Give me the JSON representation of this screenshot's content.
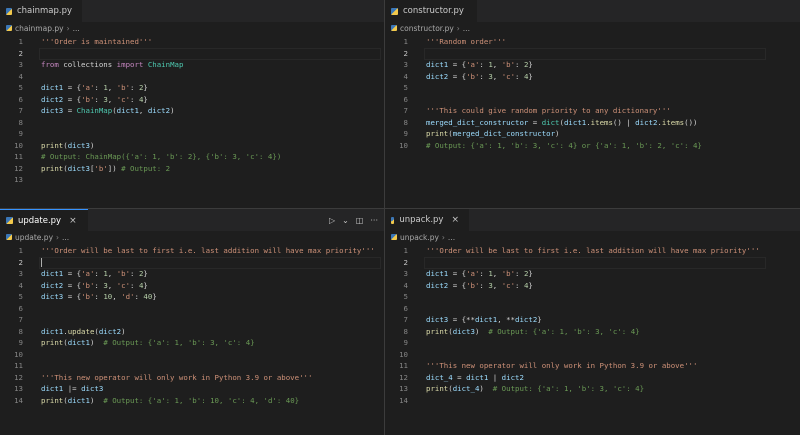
{
  "panes": {
    "chainmap": {
      "tab": "chainmap.py",
      "crumb": "chainmap.py",
      "ellipsis": "...",
      "lines": [
        [
          {
            "t": "'''Order is maintained'''",
            "c": "str"
          }
        ],
        [],
        [
          {
            "t": "from",
            "c": "kw"
          },
          {
            "t": " collections ",
            "c": "txt"
          },
          {
            "t": "import",
            "c": "kw"
          },
          {
            "t": " ChainMap",
            "c": "cls"
          }
        ],
        [],
        [
          {
            "t": "dict1",
            "c": "var"
          },
          {
            "t": " = {",
            "c": "txt"
          },
          {
            "t": "'a'",
            "c": "str"
          },
          {
            "t": ": ",
            "c": "txt"
          },
          {
            "t": "1",
            "c": "num"
          },
          {
            "t": ", ",
            "c": "txt"
          },
          {
            "t": "'b'",
            "c": "str"
          },
          {
            "t": ": ",
            "c": "txt"
          },
          {
            "t": "2",
            "c": "num"
          },
          {
            "t": "}",
            "c": "txt"
          }
        ],
        [
          {
            "t": "dict2",
            "c": "var"
          },
          {
            "t": " = {",
            "c": "txt"
          },
          {
            "t": "'b'",
            "c": "str"
          },
          {
            "t": ": ",
            "c": "txt"
          },
          {
            "t": "3",
            "c": "num"
          },
          {
            "t": ", ",
            "c": "txt"
          },
          {
            "t": "'c'",
            "c": "str"
          },
          {
            "t": ": ",
            "c": "txt"
          },
          {
            "t": "4",
            "c": "num"
          },
          {
            "t": "}",
            "c": "txt"
          }
        ],
        [
          {
            "t": "dict3",
            "c": "var"
          },
          {
            "t": " = ",
            "c": "txt"
          },
          {
            "t": "ChainMap",
            "c": "cls"
          },
          {
            "t": "(",
            "c": "txt"
          },
          {
            "t": "dict1",
            "c": "var"
          },
          {
            "t": ", ",
            "c": "txt"
          },
          {
            "t": "dict2",
            "c": "var"
          },
          {
            "t": ")",
            "c": "txt"
          }
        ],
        [],
        [],
        [
          {
            "t": "print",
            "c": "fn"
          },
          {
            "t": "(",
            "c": "txt"
          },
          {
            "t": "dict3",
            "c": "var"
          },
          {
            "t": ")",
            "c": "txt"
          }
        ],
        [
          {
            "t": "# Output: ChainMap({'a': 1, 'b': 2}, {'b': 3, 'c': 4})",
            "c": "com"
          }
        ],
        [
          {
            "t": "print",
            "c": "fn"
          },
          {
            "t": "(",
            "c": "txt"
          },
          {
            "t": "dict3",
            "c": "var"
          },
          {
            "t": "[",
            "c": "txt"
          },
          {
            "t": "'b'",
            "c": "str"
          },
          {
            "t": "]) ",
            "c": "txt"
          },
          {
            "t": "# Output: 2",
            "c": "com"
          }
        ],
        []
      ]
    },
    "constructor": {
      "tab": "constructor.py",
      "crumb": "constructor.py",
      "ellipsis": "...",
      "lines": [
        [
          {
            "t": "'''Random order'''",
            "c": "str"
          }
        ],
        [],
        [
          {
            "t": "dict1",
            "c": "var"
          },
          {
            "t": " = {",
            "c": "txt"
          },
          {
            "t": "'a'",
            "c": "str"
          },
          {
            "t": ": ",
            "c": "txt"
          },
          {
            "t": "1",
            "c": "num"
          },
          {
            "t": ", ",
            "c": "txt"
          },
          {
            "t": "'b'",
            "c": "str"
          },
          {
            "t": ": ",
            "c": "txt"
          },
          {
            "t": "2",
            "c": "num"
          },
          {
            "t": "}",
            "c": "txt"
          }
        ],
        [
          {
            "t": "dict2",
            "c": "var"
          },
          {
            "t": " = {",
            "c": "txt"
          },
          {
            "t": "'b'",
            "c": "str"
          },
          {
            "t": ": ",
            "c": "txt"
          },
          {
            "t": "3",
            "c": "num"
          },
          {
            "t": ", ",
            "c": "txt"
          },
          {
            "t": "'c'",
            "c": "str"
          },
          {
            "t": ": ",
            "c": "txt"
          },
          {
            "t": "4",
            "c": "num"
          },
          {
            "t": "}",
            "c": "txt"
          }
        ],
        [],
        [],
        [
          {
            "t": "'''This could give random priority to any dictionary'''",
            "c": "str"
          }
        ],
        [
          {
            "t": "merged_dict_constructor",
            "c": "var"
          },
          {
            "t": " = ",
            "c": "txt"
          },
          {
            "t": "dict",
            "c": "cls"
          },
          {
            "t": "(",
            "c": "txt"
          },
          {
            "t": "dict1",
            "c": "var"
          },
          {
            "t": ".",
            "c": "txt"
          },
          {
            "t": "items",
            "c": "fn"
          },
          {
            "t": "() | ",
            "c": "txt"
          },
          {
            "t": "dict2",
            "c": "var"
          },
          {
            "t": ".",
            "c": "txt"
          },
          {
            "t": "items",
            "c": "fn"
          },
          {
            "t": "())",
            "c": "txt"
          }
        ],
        [
          {
            "t": "print",
            "c": "fn"
          },
          {
            "t": "(",
            "c": "txt"
          },
          {
            "t": "merged_dict_constructor",
            "c": "var"
          },
          {
            "t": ")",
            "c": "txt"
          }
        ],
        [
          {
            "t": "# Output: {'a': 1, 'b': 3, 'c': 4} or {'a': 1, 'b': 2, 'c': 4}",
            "c": "com"
          }
        ]
      ]
    },
    "update": {
      "tab": "update.py",
      "crumb": "update.py",
      "ellipsis": "...",
      "lines": [
        [
          {
            "t": "'''Order will be last to first i.e. last addition will have max priority'''",
            "c": "str"
          }
        ],
        [],
        [
          {
            "t": "dict1",
            "c": "var"
          },
          {
            "t": " = {",
            "c": "txt"
          },
          {
            "t": "'a'",
            "c": "str"
          },
          {
            "t": ": ",
            "c": "txt"
          },
          {
            "t": "1",
            "c": "num"
          },
          {
            "t": ", ",
            "c": "txt"
          },
          {
            "t": "'b'",
            "c": "str"
          },
          {
            "t": ": ",
            "c": "txt"
          },
          {
            "t": "2",
            "c": "num"
          },
          {
            "t": "}",
            "c": "txt"
          }
        ],
        [
          {
            "t": "dict2",
            "c": "var"
          },
          {
            "t": " = {",
            "c": "txt"
          },
          {
            "t": "'b'",
            "c": "str"
          },
          {
            "t": ": ",
            "c": "txt"
          },
          {
            "t": "3",
            "c": "num"
          },
          {
            "t": ", ",
            "c": "txt"
          },
          {
            "t": "'c'",
            "c": "str"
          },
          {
            "t": ": ",
            "c": "txt"
          },
          {
            "t": "4",
            "c": "num"
          },
          {
            "t": "}",
            "c": "txt"
          }
        ],
        [
          {
            "t": "dict3",
            "c": "var"
          },
          {
            "t": " = {",
            "c": "txt"
          },
          {
            "t": "'b'",
            "c": "str"
          },
          {
            "t": ": ",
            "c": "txt"
          },
          {
            "t": "10",
            "c": "num"
          },
          {
            "t": ", ",
            "c": "txt"
          },
          {
            "t": "'d'",
            "c": "str"
          },
          {
            "t": ": ",
            "c": "txt"
          },
          {
            "t": "40",
            "c": "num"
          },
          {
            "t": "}",
            "c": "txt"
          }
        ],
        [],
        [],
        [
          {
            "t": "dict1",
            "c": "var"
          },
          {
            "t": ".",
            "c": "txt"
          },
          {
            "t": "update",
            "c": "fn"
          },
          {
            "t": "(",
            "c": "txt"
          },
          {
            "t": "dict2",
            "c": "var"
          },
          {
            "t": ")",
            "c": "txt"
          }
        ],
        [
          {
            "t": "print",
            "c": "fn"
          },
          {
            "t": "(",
            "c": "txt"
          },
          {
            "t": "dict1",
            "c": "var"
          },
          {
            "t": ")  ",
            "c": "txt"
          },
          {
            "t": "# Output: {'a': 1, 'b': 3, 'c': 4}",
            "c": "com"
          }
        ],
        [],
        [],
        [
          {
            "t": "'''This new operator will only work in Python 3.9 or above'''",
            "c": "str"
          }
        ],
        [
          {
            "t": "dict1",
            "c": "var"
          },
          {
            "t": " |= ",
            "c": "txt"
          },
          {
            "t": "dict3",
            "c": "var"
          }
        ],
        [
          {
            "t": "print",
            "c": "fn"
          },
          {
            "t": "(",
            "c": "txt"
          },
          {
            "t": "dict1",
            "c": "var"
          },
          {
            "t": ")  ",
            "c": "txt"
          },
          {
            "t": "# Output: {'a': 1, 'b': 10, 'c': 4, 'd': 40}",
            "c": "com"
          }
        ]
      ]
    },
    "unpack": {
      "tab": "unpack.py",
      "crumb": "unpack.py",
      "ellipsis": "...",
      "lines": [
        [
          {
            "t": "'''Order will be last to first i.e. last addition will have max priority'''",
            "c": "str"
          }
        ],
        [],
        [
          {
            "t": "dict1",
            "c": "var"
          },
          {
            "t": " = {",
            "c": "txt"
          },
          {
            "t": "'a'",
            "c": "str"
          },
          {
            "t": ": ",
            "c": "txt"
          },
          {
            "t": "1",
            "c": "num"
          },
          {
            "t": ", ",
            "c": "txt"
          },
          {
            "t": "'b'",
            "c": "str"
          },
          {
            "t": ": ",
            "c": "txt"
          },
          {
            "t": "2",
            "c": "num"
          },
          {
            "t": "}",
            "c": "txt"
          }
        ],
        [
          {
            "t": "dict2",
            "c": "var"
          },
          {
            "t": " = {",
            "c": "txt"
          },
          {
            "t": "'b'",
            "c": "str"
          },
          {
            "t": ": ",
            "c": "txt"
          },
          {
            "t": "3",
            "c": "num"
          },
          {
            "t": ", ",
            "c": "txt"
          },
          {
            "t": "'c'",
            "c": "str"
          },
          {
            "t": ": ",
            "c": "txt"
          },
          {
            "t": "4",
            "c": "num"
          },
          {
            "t": "}",
            "c": "txt"
          }
        ],
        [],
        [],
        [
          {
            "t": "dict3",
            "c": "var"
          },
          {
            "t": " = {**",
            "c": "txt"
          },
          {
            "t": "dict1",
            "c": "var"
          },
          {
            "t": ", **",
            "c": "txt"
          },
          {
            "t": "dict2",
            "c": "var"
          },
          {
            "t": "}",
            "c": "txt"
          }
        ],
        [
          {
            "t": "print",
            "c": "fn"
          },
          {
            "t": "(",
            "c": "txt"
          },
          {
            "t": "dict3",
            "c": "var"
          },
          {
            "t": ")  ",
            "c": "txt"
          },
          {
            "t": "# Output: {'a': 1, 'b': 3, 'c': 4}",
            "c": "com"
          }
        ],
        [],
        [],
        [
          {
            "t": "'''This new operator will only work in Python 3.9 or above'''",
            "c": "str"
          }
        ],
        [
          {
            "t": "dict_4",
            "c": "var"
          },
          {
            "t": " = ",
            "c": "txt"
          },
          {
            "t": "dict1",
            "c": "var"
          },
          {
            "t": " | ",
            "c": "txt"
          },
          {
            "t": "dict2",
            "c": "var"
          }
        ],
        [
          {
            "t": "print",
            "c": "fn"
          },
          {
            "t": "(",
            "c": "txt"
          },
          {
            "t": "dict_4",
            "c": "var"
          },
          {
            "t": ")  ",
            "c": "txt"
          },
          {
            "t": "# Output: {'a': 1, 'b': 3, 'c': 4}",
            "c": "com"
          }
        ],
        []
      ]
    }
  },
  "icons": {
    "python": "python-file-icon",
    "close": "close-icon",
    "run": "run-icon",
    "dropdown": "chevron-down-icon",
    "split": "split-editor-icon",
    "more": "more-actions-icon"
  },
  "glyphs": {
    "close": "×",
    "run": "▷",
    "dropdown": "⌄",
    "split": "◫",
    "more": "···",
    "chevron": "›"
  },
  "colors": {
    "accent": "#3794ff",
    "background": "#1e1e1e",
    "string": "#ce9178",
    "keyword": "#c586c0",
    "comment": "#6a9955"
  }
}
